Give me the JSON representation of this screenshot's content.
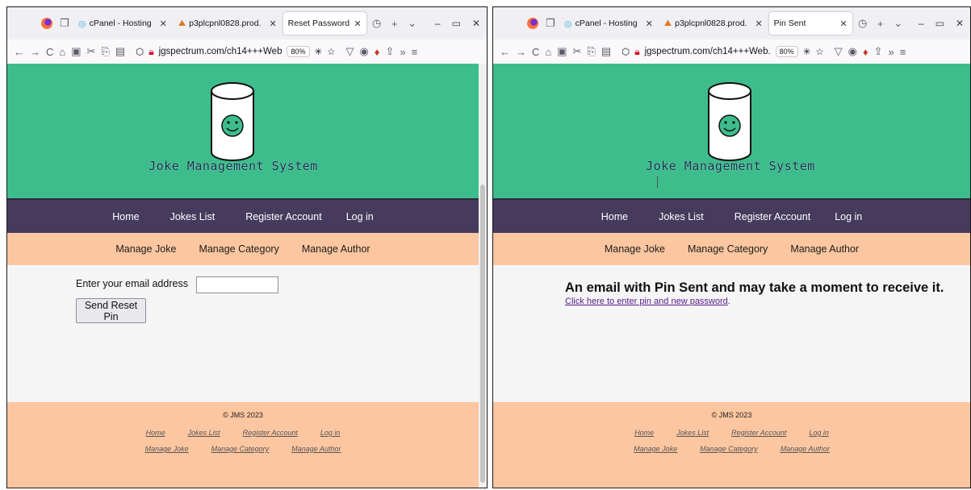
{
  "left": {
    "tabs": [
      {
        "title": "cPanel - Hosting",
        "active": false
      },
      {
        "title": "p3plcpnl0828.prod.",
        "active": false
      },
      {
        "title": "Reset Password",
        "active": true
      }
    ],
    "url": "jgspectrum.com/ch14+++Web",
    "zoom": "80%",
    "site": {
      "logo_title": "Joke Management System",
      "nav": [
        "Home",
        "Jokes List",
        "Register Account",
        "Log in"
      ],
      "subnav": [
        "Manage Joke",
        "Manage Category",
        "Manage Author"
      ],
      "form": {
        "email_label": "Enter your email address",
        "email_value": "",
        "submit_label": "Send Reset Pin"
      },
      "footer": {
        "copyright": "© JMS 2023",
        "links_row1": [
          "Home",
          "Jokes List",
          "Register Account",
          "Log in"
        ],
        "links_row2": [
          "Manage Joke",
          "Manage Category",
          "Manage Author"
        ]
      }
    }
  },
  "right": {
    "tabs": [
      {
        "title": "cPanel - Hosting",
        "active": false
      },
      {
        "title": "p3plcpnl0828.prod.",
        "active": false
      },
      {
        "title": "Pin Sent",
        "active": true
      }
    ],
    "url": "jgspectrum.com/ch14+++Web.",
    "zoom": "80%",
    "site": {
      "logo_title": "Joke Management System",
      "nav": [
        "Home",
        "Jokes List",
        "Register Account",
        "Log in"
      ],
      "subnav": [
        "Manage Joke",
        "Manage Category",
        "Manage Author"
      ],
      "message": "An email with Pin Sent and may take a moment to receive it.",
      "link_text": "Click here to enter pin and new password",
      "link_suffix": ".",
      "footer": {
        "copyright": "© JMS 2023",
        "links_row1": [
          "Home",
          "Jokes List",
          "Register Account",
          "Log in"
        ],
        "links_row2": [
          "Manage Joke",
          "Manage Category",
          "Manage Author"
        ]
      }
    }
  },
  "colors": {
    "header_green": "#3dbd8c",
    "nav_purple": "#463b5d",
    "peach": "#fcc6a0",
    "link_visited": "#551a8b"
  },
  "icons": [
    "firefox-icon",
    "tab-manager-icon",
    "cpanel-icon",
    "cpanel-domain-icon",
    "history-icon",
    "new-tab-icon",
    "list-tabs-icon",
    "back-icon",
    "forward-icon",
    "reload-icon",
    "shield-icon",
    "lock-icon",
    "bookmark-star-icon",
    "pocket-icon",
    "account-icon",
    "extension-icon",
    "share-icon",
    "overflow-icon",
    "menu-icon"
  ]
}
